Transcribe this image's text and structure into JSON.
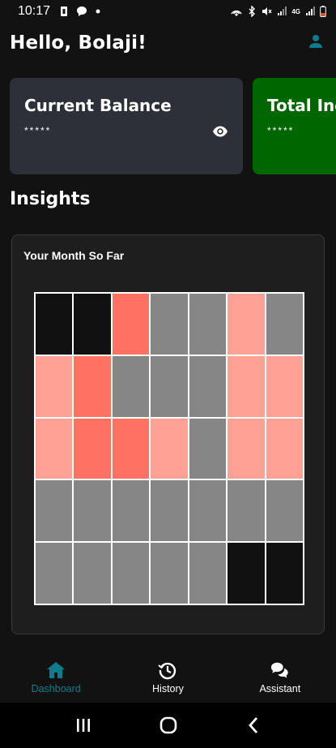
{
  "status_bar": {
    "time": "10:17",
    "network_label": "4G"
  },
  "header": {
    "greeting": "Hello, Bolaji!"
  },
  "cards": [
    {
      "title": "Current Balance",
      "masked_value": "*****",
      "bg": "#2d3039"
    },
    {
      "title": "Total Income",
      "masked_value": "*****",
      "bg": "#006600"
    }
  ],
  "insights": {
    "section_title": "Insights",
    "card_title": "Your Month So Far",
    "colors": {
      "none": "#111111",
      "neutral": "#868686",
      "light": "#ffa195",
      "strong": "#ff7262"
    },
    "grid": [
      [
        "none",
        "none",
        "strong",
        "neutral",
        "neutral",
        "light",
        "neutral"
      ],
      [
        "light",
        "strong",
        "neutral",
        "neutral",
        "neutral",
        "light",
        "light"
      ],
      [
        "light",
        "strong",
        "strong",
        "light",
        "neutral",
        "light",
        "light"
      ],
      [
        "neutral",
        "neutral",
        "neutral",
        "neutral",
        "neutral",
        "neutral",
        "neutral"
      ],
      [
        "neutral",
        "neutral",
        "neutral",
        "neutral",
        "neutral",
        "none",
        "none"
      ]
    ]
  },
  "bottom_nav": {
    "accent": "#0d7c8c",
    "items": [
      {
        "label": "Dashboard",
        "icon": "home-icon",
        "active": true
      },
      {
        "label": "History",
        "icon": "history-icon",
        "active": false
      },
      {
        "label": "Assistant",
        "icon": "chat-icon",
        "active": false
      }
    ]
  }
}
